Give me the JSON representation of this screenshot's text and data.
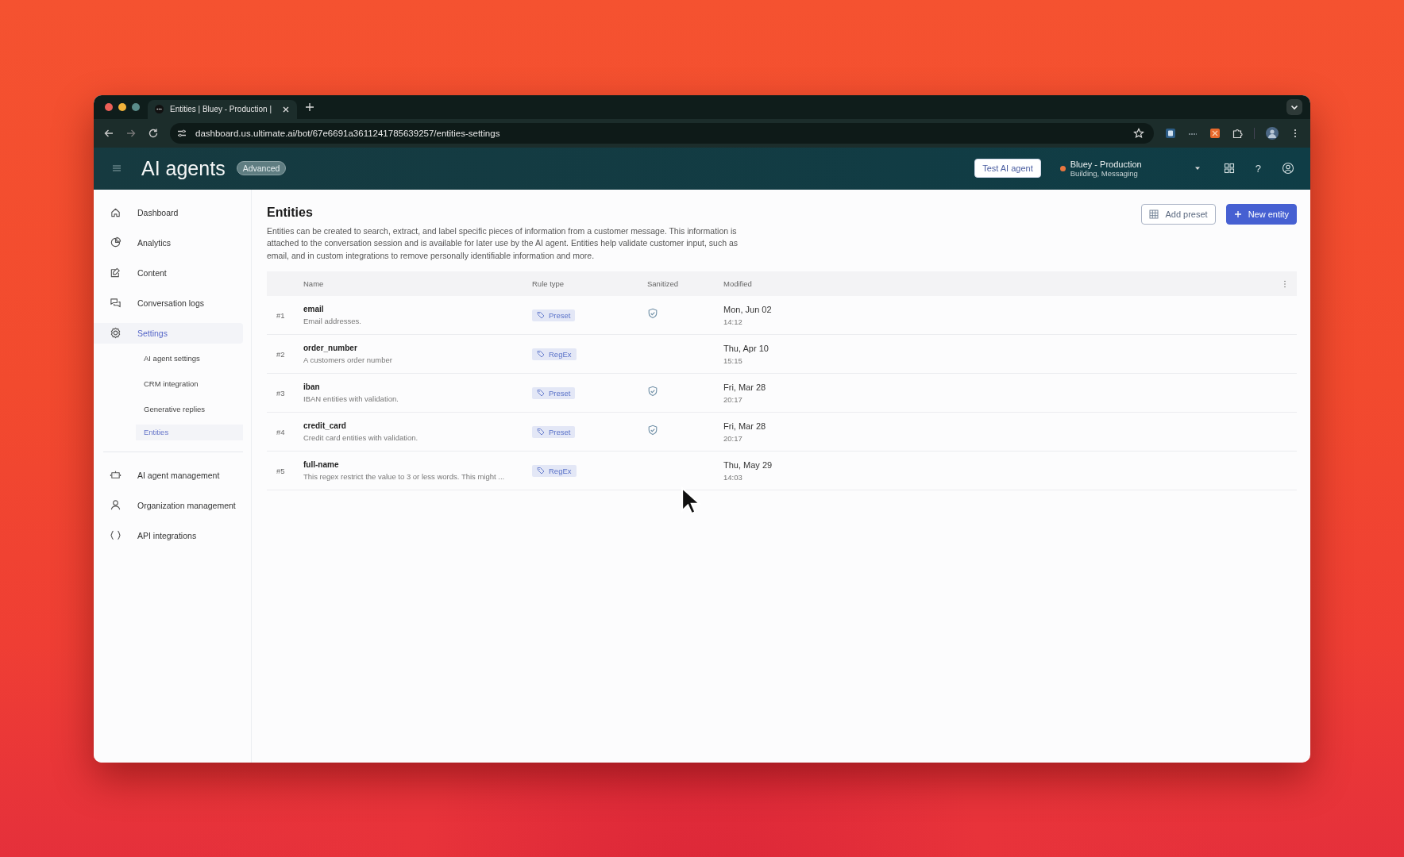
{
  "browser": {
    "tab_title": "Entities | Bluey - Production |",
    "url": "dashboard.us.ultimate.ai/bot/67e6691a3611241785639257/entities-settings"
  },
  "header": {
    "title": "AI agents",
    "badge": "Advanced",
    "test_button": "Test AI agent",
    "project": {
      "name": "Bluey - Production",
      "subtitle": "Building, Messaging"
    },
    "help": "?"
  },
  "sidebar": {
    "groups": [
      {
        "items": [
          {
            "label": "Dashboard",
            "selected": false
          },
          {
            "label": "Analytics",
            "selected": false
          },
          {
            "label": "Content",
            "selected": false
          },
          {
            "label": "Conversation logs",
            "selected": false
          },
          {
            "label": "Settings",
            "selected": true,
            "children": [
              {
                "label": "AI agent settings",
                "selected": false
              },
              {
                "label": "CRM integration",
                "selected": false
              },
              {
                "label": "Generative replies",
                "selected": false
              },
              {
                "label": "Entities",
                "selected": true
              }
            ]
          }
        ]
      },
      {
        "items": [
          {
            "label": "AI agent management",
            "selected": false
          },
          {
            "label": "Organization management",
            "selected": false
          },
          {
            "label": "API integrations",
            "selected": false
          }
        ]
      }
    ]
  },
  "page": {
    "title": "Entities",
    "description": "Entities can be created to search, extract, and label specific pieces of information from a customer message. This information is attached to the conversation session and is available for later use by the AI agent. Entities help validate customer input, such as email, and in custom integrations to remove personally identifiable information and more.",
    "buttons": [
      {
        "label": "Add preset",
        "kind": "secondary"
      },
      {
        "label": "New entity",
        "kind": "primary"
      }
    ]
  },
  "table": {
    "columns": [
      "Name",
      "Rule type",
      "Sanitized",
      "Modified"
    ],
    "rows": [
      {
        "index": "#1",
        "name": "email",
        "description": "Email addresses.",
        "rule_type": "Preset",
        "sanitized": true,
        "date": "Mon, Jun 02",
        "time": "14:12"
      },
      {
        "index": "#2",
        "name": "order_number",
        "description": "A customers order number",
        "rule_type": "RegEx",
        "sanitized": false,
        "date": "Thu, Apr 10",
        "time": "15:15"
      },
      {
        "index": "#3",
        "name": "iban",
        "description": "IBAN entities with validation.",
        "rule_type": "Preset",
        "sanitized": true,
        "date": "Fri, Mar 28",
        "time": "20:17"
      },
      {
        "index": "#4",
        "name": "credit_card",
        "description": "Credit card entities with validation.",
        "rule_type": "Preset",
        "sanitized": true,
        "date": "Fri, Mar 28",
        "time": "20:17"
      },
      {
        "index": "#5",
        "name": "full-name",
        "description": "This regex restrict the value to 3 or less words. This might ...",
        "rule_type": "RegEx",
        "sanitized": false,
        "date": "Thu, May 29",
        "time": "14:03"
      }
    ]
  }
}
